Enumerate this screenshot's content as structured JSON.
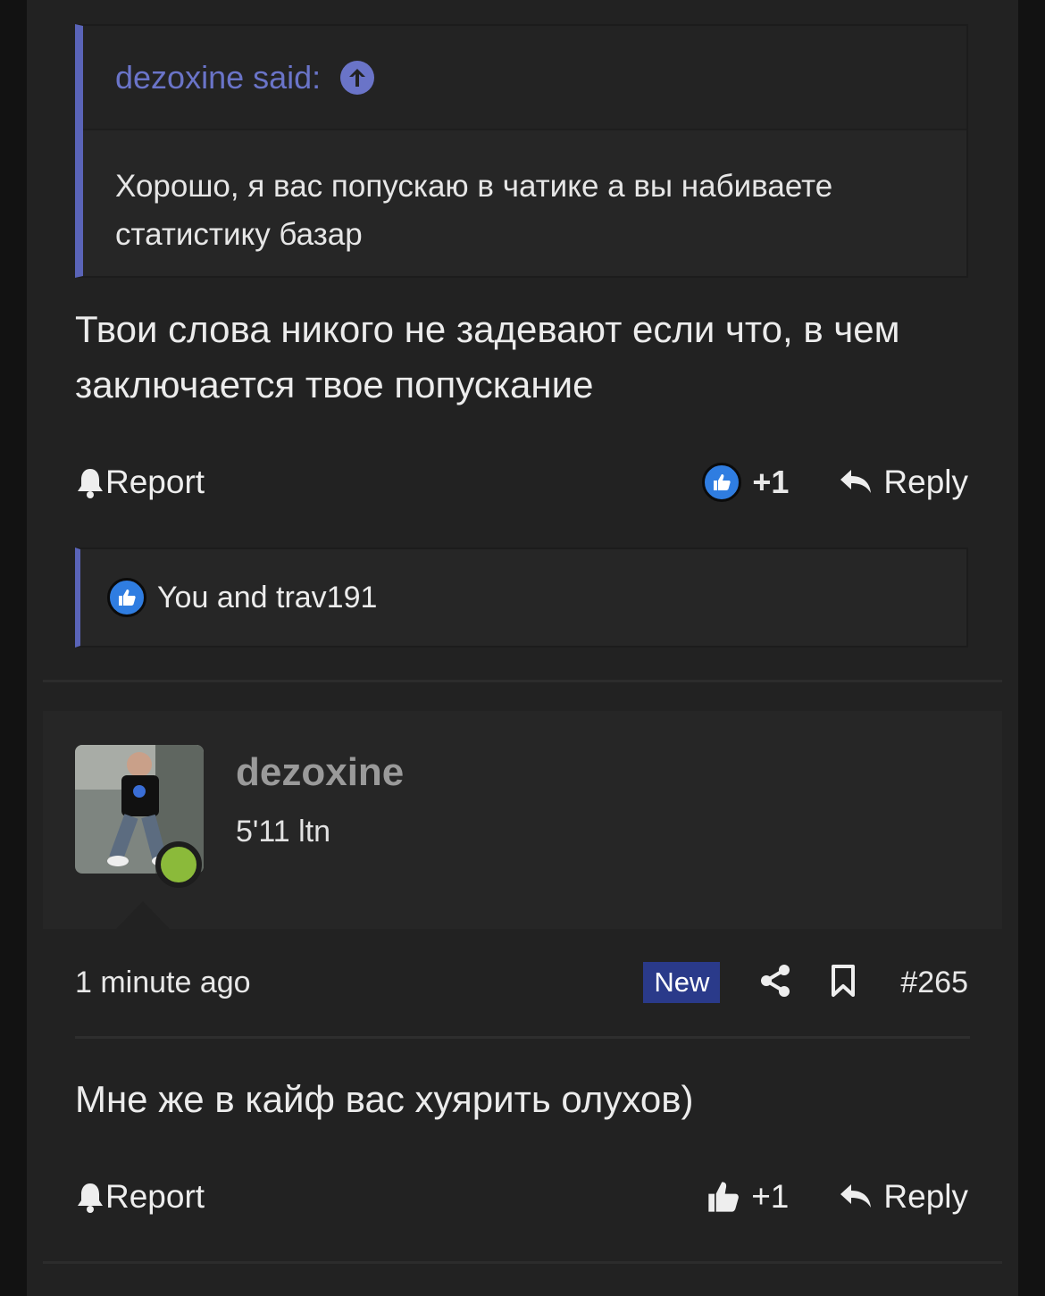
{
  "quote": {
    "author_said": "dezoxine said:",
    "text": "Хорошо, я вас попускаю в чатике а вы набиваете статистику базар"
  },
  "post1": {
    "text": "Твои слова никого не задевают если что, в чем заключается твое попускание",
    "report_label": "Report",
    "reaction_count": "+1",
    "reply_label": "Reply",
    "reactions_text": "You and trav191"
  },
  "post2": {
    "username": "dezoxine",
    "user_title": "5'11 ltn",
    "time": "1 minute ago",
    "new_badge": "New",
    "post_number": "#265",
    "text": "Мне же в кайф вас хуярить олухов)",
    "report_label": "Report",
    "like_count": "+1",
    "reply_label": "Reply"
  },
  "colors": {
    "accent": "#5a64b8",
    "online": "#8bba3a",
    "like_badge": "#2f7de1",
    "new_badge": "#2a3a8a"
  },
  "icons": [
    "arrow-up-circle-icon",
    "bell-icon",
    "thumbs-up-icon",
    "reply-icon",
    "share-icon",
    "bookmark-icon"
  ]
}
